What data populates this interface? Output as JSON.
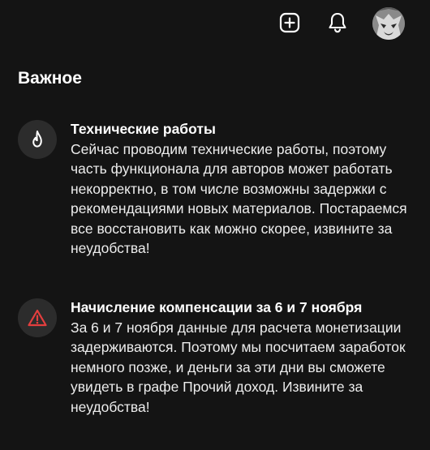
{
  "header": {
    "icons": [
      "plus-square-icon",
      "bell-icon",
      "avatar"
    ],
    "accent": "#e53e3e"
  },
  "section": {
    "title": "Важное"
  },
  "notices": [
    {
      "icon": "flame-icon",
      "title": "Технические работы",
      "lines": [
        "Сейчас проводим технические работы, поэтому",
        "часть функционала для авторов может работать",
        "некорректно, в том числе возможны задержки с",
        "рекомендациями новых материалов. Постараемся",
        "все восстановить как можно скорее, извините за",
        "неудобства!"
      ]
    },
    {
      "icon": "warning-triangle-icon",
      "title": "Начисление компенсации за 6 и 7 ноября",
      "lines": [
        "За 6 и 7 ноября данные для расчета монетизации",
        "задерживаются. Поэтому мы посчитаем заработок",
        "немного позже, и деньги за эти дни вы сможете",
        "увидеть в графе Прочий доход. Извините за",
        "неудобства!"
      ]
    }
  ]
}
